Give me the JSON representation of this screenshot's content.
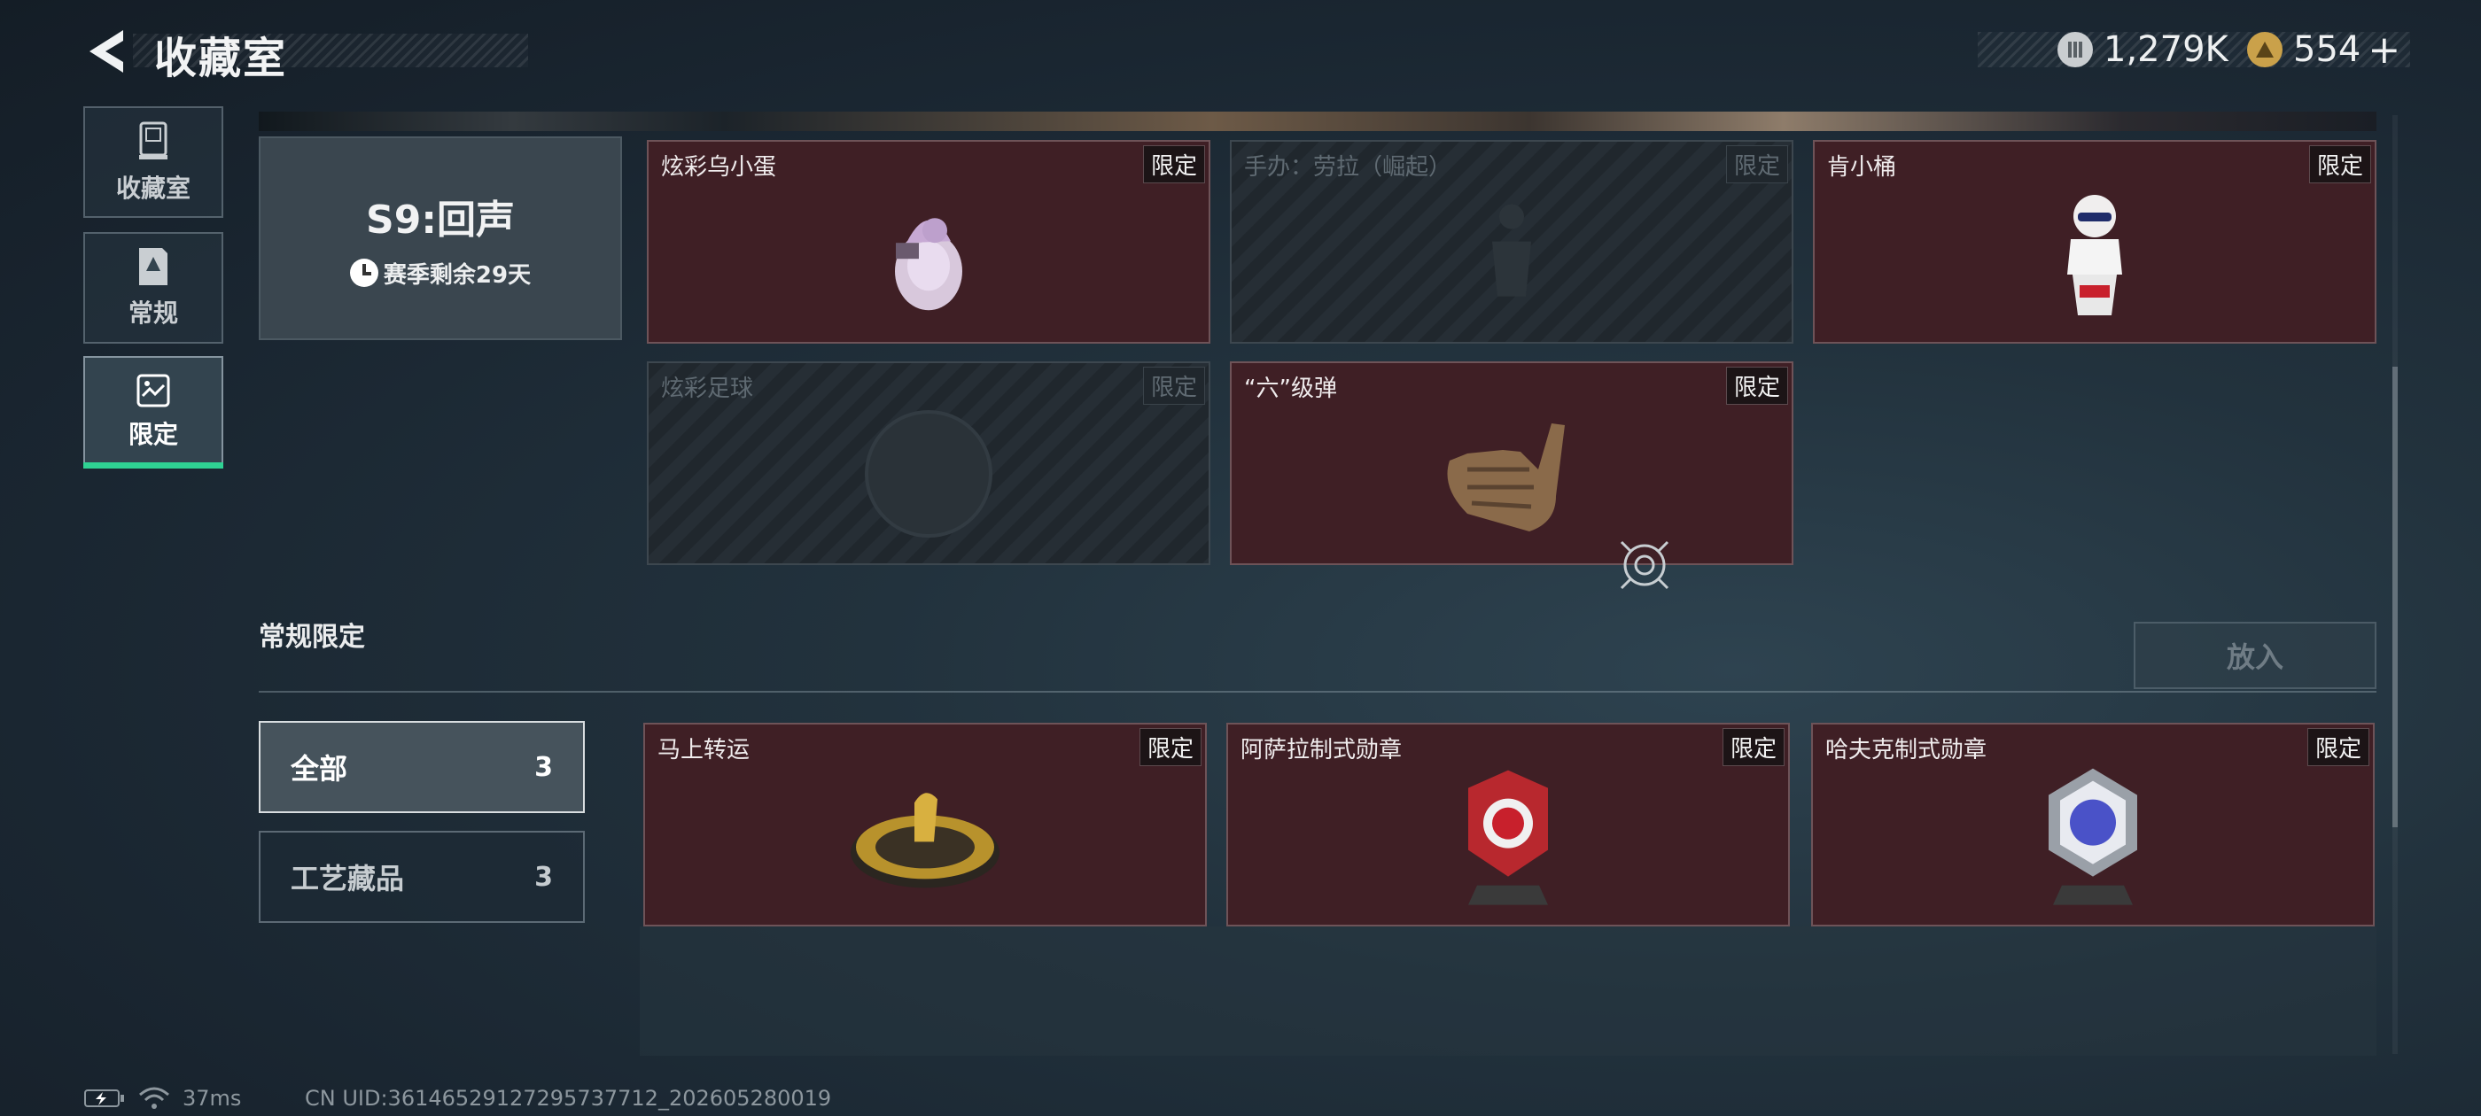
{
  "header": {
    "title": "收藏室",
    "currency_silver": "1,279K",
    "currency_gold": "554",
    "add_symbol": "+"
  },
  "sidebar": {
    "items": [
      {
        "label": "收藏室",
        "icon": "trophy-icon"
      },
      {
        "label": "常规",
        "icon": "card-icon"
      },
      {
        "label": "限定",
        "icon": "image-icon",
        "active": true
      }
    ]
  },
  "season": {
    "name": "S9:回声",
    "remaining": "赛季剩余29天"
  },
  "limited_items": [
    {
      "name": "炫彩乌小蛋",
      "badge": "限定",
      "locked": false
    },
    {
      "name": "手办：劳拉（崛起）",
      "badge": "限定",
      "locked": true
    },
    {
      "name": "肯小桶",
      "badge": "限定",
      "locked": false
    },
    {
      "name": "炫彩足球",
      "badge": "限定",
      "locked": true
    },
    {
      "name": "“六”级弹",
      "badge": "限定",
      "locked": false
    }
  ],
  "section": {
    "title": "常规限定",
    "put_button": "放入"
  },
  "filters": [
    {
      "label": "全部",
      "count": "3",
      "active": true
    },
    {
      "label": "工艺藏品",
      "count": "3",
      "active": false
    }
  ],
  "regular_items": [
    {
      "name": "马上转运",
      "badge": "限定"
    },
    {
      "name": "阿萨拉制式勋章",
      "badge": "限定"
    },
    {
      "name": "哈夫克制式勋章",
      "badge": "限定"
    }
  ],
  "status_bar": {
    "ping": "37ms",
    "uid": "CN UID:3614652912729573​7712_202605280019"
  },
  "colors": {
    "accent": "#2fd293",
    "card_bg": "#3f1f25"
  }
}
